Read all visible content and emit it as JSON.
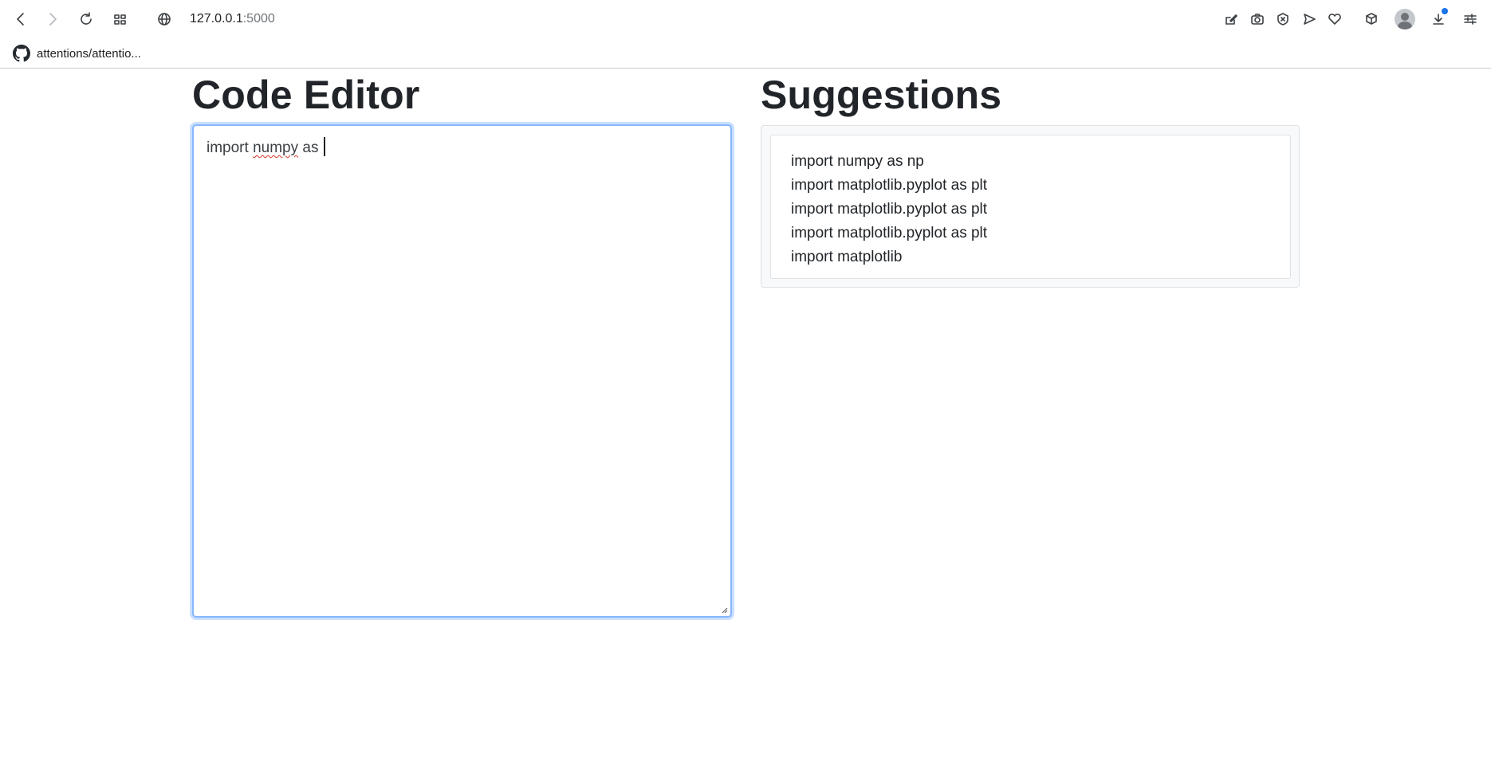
{
  "browser": {
    "url_host": "127.0.0.1",
    "url_port": ":5000",
    "bookmark_label": "attentions/attentio...",
    "accent_color": "#1a73e8"
  },
  "icons": {
    "back": "arrow-left-icon",
    "forward": "arrow-right-icon",
    "reload": "reload-icon",
    "tabs": "grid-icon",
    "site": "globe-icon",
    "github": "github-icon"
  },
  "editor": {
    "title": "Code Editor",
    "text_before": "import ",
    "text_misspelled": "numpy",
    "text_after": " as "
  },
  "suggestions": {
    "title": "Suggestions",
    "items": [
      "import numpy as np",
      "import matplotlib.pyplot as plt",
      "import matplotlib.pyplot as plt",
      "import matplotlib.pyplot as plt",
      "import matplotlib"
    ]
  }
}
